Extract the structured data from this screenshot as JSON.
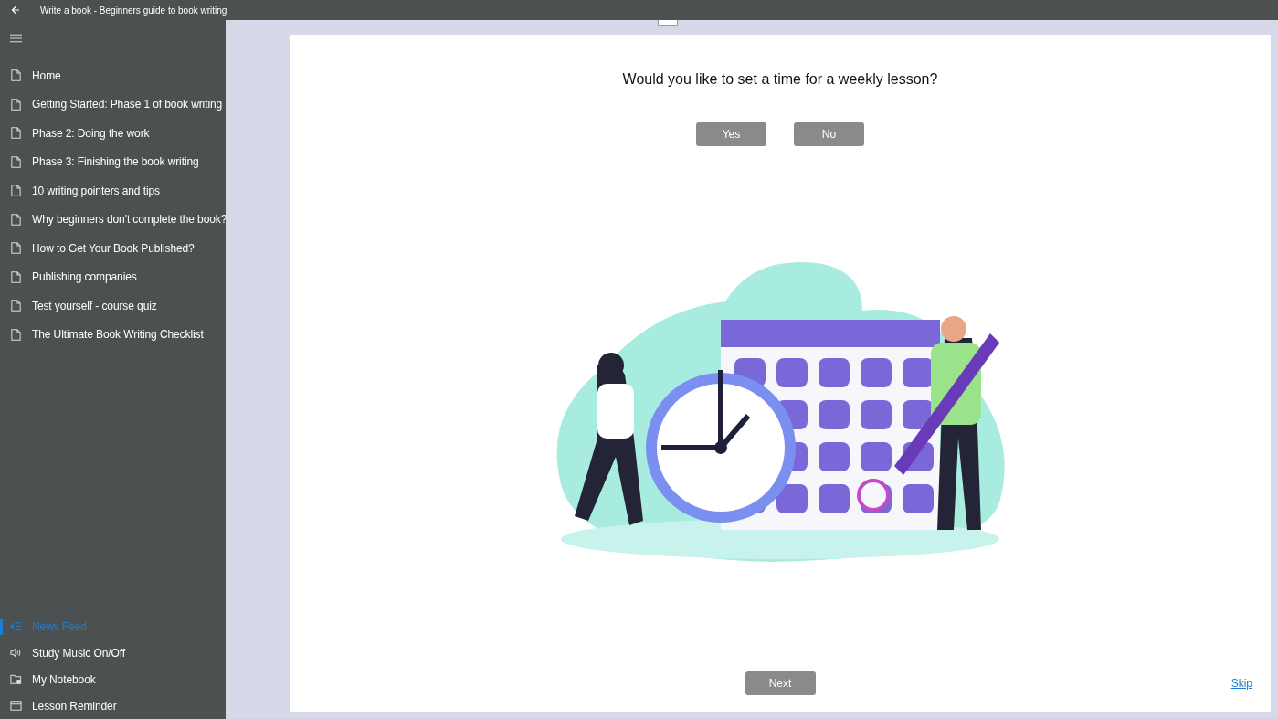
{
  "window": {
    "title": "Write a book - Beginners guide to book writing"
  },
  "sidebar": {
    "items": [
      {
        "label": "Home",
        "selected": false
      },
      {
        "label": "Getting Started: Phase 1 of book writing",
        "selected": false
      },
      {
        "label": "Phase 2: Doing the work",
        "selected": false
      },
      {
        "label": "Phase 3: Finishing the book writing",
        "selected": false
      },
      {
        "label": "10 writing pointers and tips",
        "selected": false
      },
      {
        "label": "Why beginners don't complete the book?",
        "selected": false
      },
      {
        "label": "How to Get Your Book Published?",
        "selected": false
      },
      {
        "label": "Publishing companies",
        "selected": false
      },
      {
        "label": "Test yourself - course quiz",
        "selected": false
      },
      {
        "label": "The Ultimate Book Writing Checklist",
        "selected": false
      }
    ],
    "footer_items": [
      {
        "label": "News Feed",
        "kind": "feed",
        "selected": true
      },
      {
        "label": "Study Music On/Off",
        "kind": "music",
        "selected": false
      },
      {
        "label": "My Notebook",
        "kind": "notebook",
        "selected": false
      },
      {
        "label": "Lesson Reminder",
        "kind": "reminder",
        "selected": false
      }
    ]
  },
  "dialog": {
    "question": "Would you like to set a time for a weekly lesson?",
    "buttons": [
      "Yes",
      "No"
    ],
    "next": "Next",
    "skip": "Skip"
  }
}
